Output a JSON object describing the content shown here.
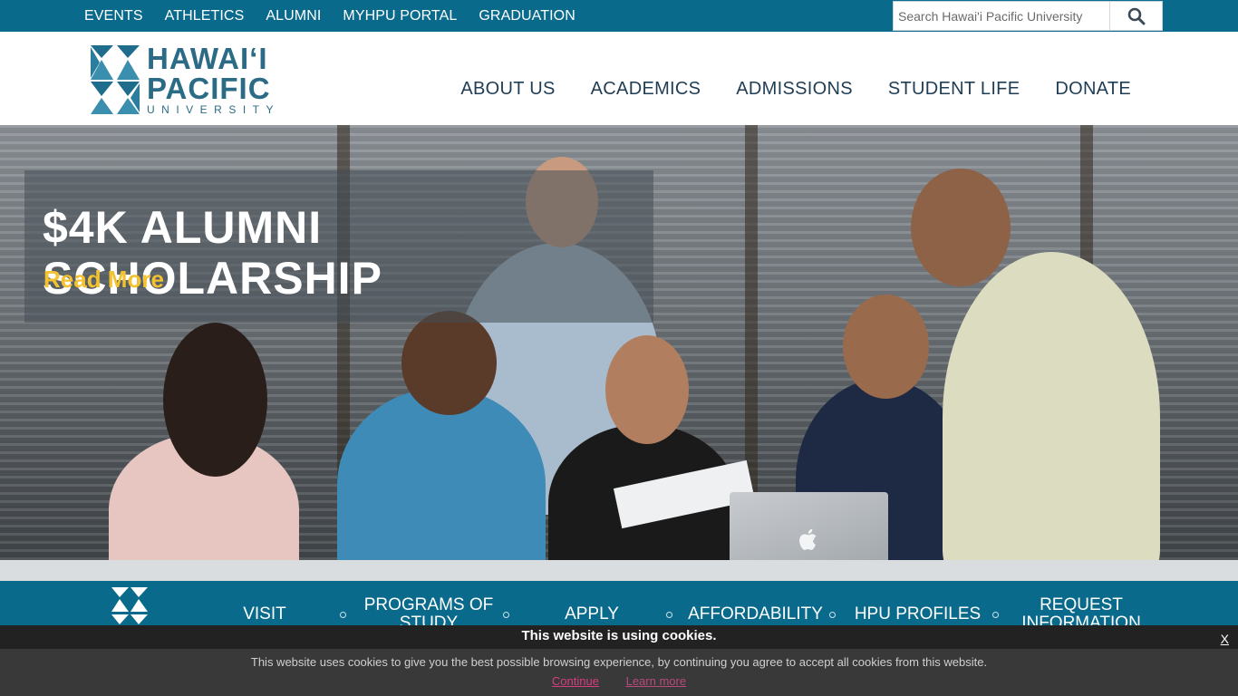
{
  "top_nav": {
    "items": [
      "EVENTS",
      "ATHLETICS",
      "ALUMNI",
      "MYHPU PORTAL",
      "GRADUATION"
    ]
  },
  "search": {
    "placeholder": "Search Hawai'i Pacific University",
    "icon": "search-icon"
  },
  "logo": {
    "line1": "HAWAIʻI",
    "line2": "PACIFIC",
    "line3": "UNIVERSITY",
    "color": "#2b6b86"
  },
  "main_nav": {
    "items": [
      "ABOUT US",
      "ACADEMICS",
      "ADMISSIONS",
      "STUDENT LIFE",
      "DONATE"
    ]
  },
  "hero": {
    "title": "$4K ALUMNI SCHOLARSHIP",
    "link": "Read More",
    "link_color": "#f2c230"
  },
  "quick_links": {
    "items": [
      "VISIT",
      "PROGRAMS OF STUDY",
      "APPLY",
      "AFFORDABILITY",
      "HPU PROFILES",
      "REQUEST INFORMATION"
    ]
  },
  "cookie": {
    "title": "This website is using cookies.",
    "message": "This website uses cookies to give you the best possible browsing experience, by continuing you agree to accept all cookies from this website.",
    "continue": "Continue",
    "learn_more": "Learn more",
    "close": "X"
  },
  "colors": {
    "brand_teal": "#0a6a8c",
    "nav_text": "#1f3d55",
    "cookie_link": "#d63d83"
  }
}
